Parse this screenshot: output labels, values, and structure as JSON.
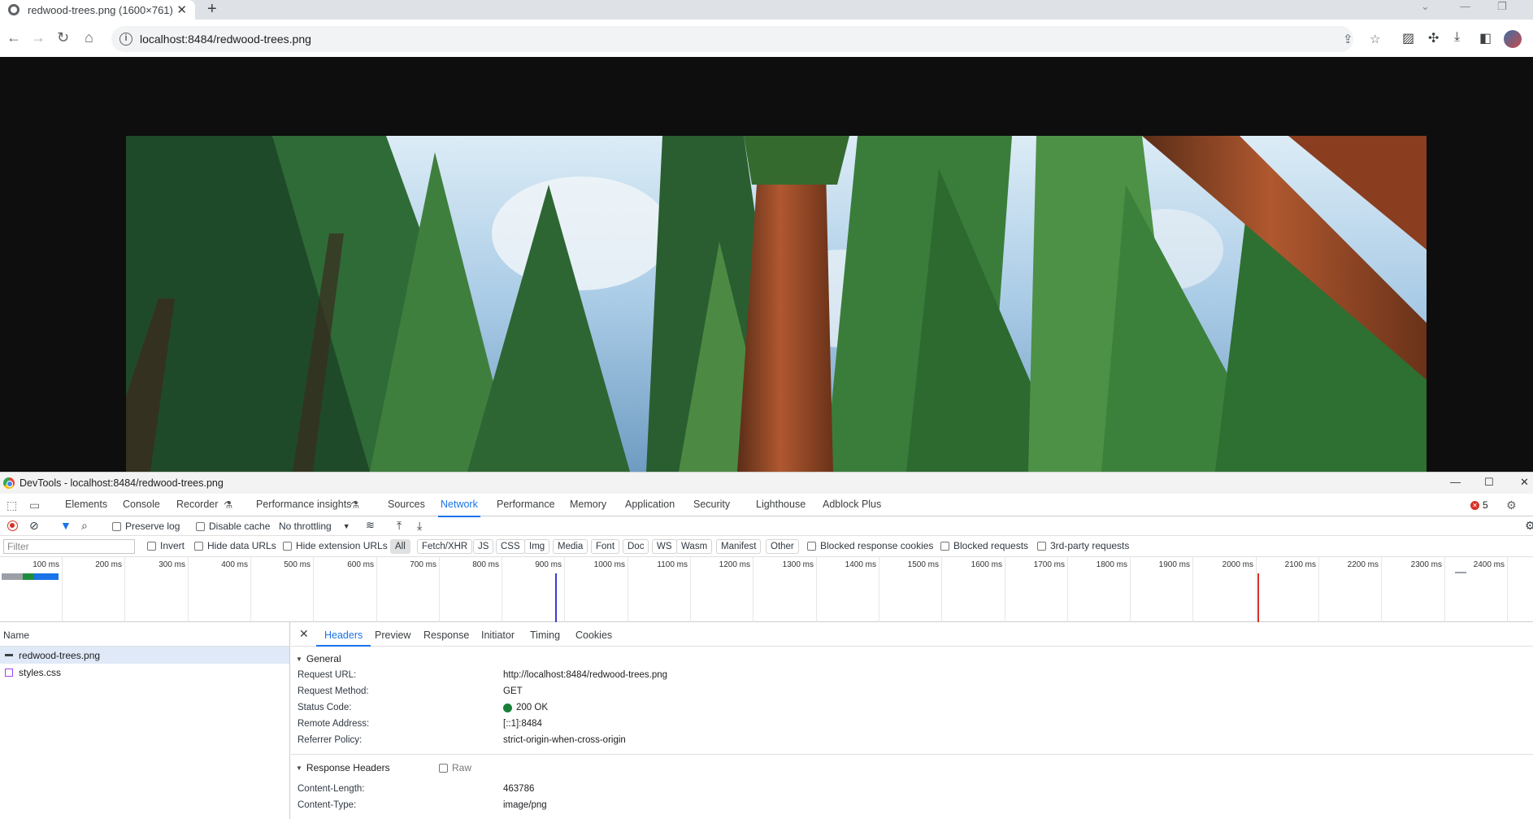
{
  "browser": {
    "tab_title": "redwood-trees.png (1600×761)",
    "new_tab": "+",
    "url": "localhost:8484/redwood-trees.png"
  },
  "page": {
    "image_alt": "redwood-trees.png"
  },
  "devtools": {
    "window_title": "DevTools - localhost:8484/redwood-trees.png",
    "tabs": [
      "Elements",
      "Console",
      "Recorder",
      "Performance insights",
      "Sources",
      "Network",
      "Performance",
      "Memory",
      "Application",
      "Security",
      "Lighthouse",
      "Adblock Plus"
    ],
    "active_tab": "Network",
    "error_count": "5",
    "network_toolbar": {
      "preserve_log": "Preserve log",
      "disable_cache": "Disable cache",
      "throttling": "No throttling"
    },
    "filter": {
      "placeholder": "Filter",
      "invert": "Invert",
      "hide_data_urls": "Hide data URLs",
      "hide_extension_urls": "Hide extension URLs",
      "types": [
        "All",
        "Fetch/XHR",
        "JS",
        "CSS",
        "Img",
        "Media",
        "Font",
        "Doc",
        "WS",
        "Wasm",
        "Manifest",
        "Other"
      ],
      "active_type": "All",
      "blocked_response_cookies": "Blocked response cookies",
      "blocked_requests": "Blocked requests",
      "third_party": "3rd-party requests"
    },
    "timeline_ticks": [
      "100 ms",
      "200 ms",
      "300 ms",
      "400 ms",
      "500 ms",
      "600 ms",
      "700 ms",
      "800 ms",
      "900 ms",
      "1000 ms",
      "1100 ms",
      "1200 ms",
      "1300 ms",
      "1400 ms",
      "1500 ms",
      "1600 ms",
      "1700 ms",
      "1800 ms",
      "1900 ms",
      "2000 ms",
      "2100 ms",
      "2200 ms",
      "2300 ms",
      "2400 ms"
    ],
    "requests": {
      "column_name": "Name",
      "items": [
        "redwood-trees.png",
        "styles.css"
      ]
    },
    "details": {
      "tabs": [
        "Headers",
        "Preview",
        "Response",
        "Initiator",
        "Timing",
        "Cookies"
      ],
      "active_tab": "Headers",
      "general": {
        "title": "General",
        "rows": [
          {
            "key": "Request URL:",
            "value": "http://localhost:8484/redwood-trees.png"
          },
          {
            "key": "Request Method:",
            "value": "GET"
          },
          {
            "key": "Status Code:",
            "value": "200 OK"
          },
          {
            "key": "Remote Address:",
            "value": "[::1]:8484"
          },
          {
            "key": "Referrer Policy:",
            "value": "strict-origin-when-cross-origin"
          }
        ]
      },
      "response_headers": {
        "title": "Response Headers",
        "raw_label": "Raw",
        "rows": [
          {
            "key": "Content-Length:",
            "value": "463786"
          },
          {
            "key": "Content-Type:",
            "value": "image/png"
          }
        ]
      }
    }
  },
  "colors": {
    "accent": "#1a73e8",
    "status_ok": "#188038",
    "error": "#d93025"
  }
}
